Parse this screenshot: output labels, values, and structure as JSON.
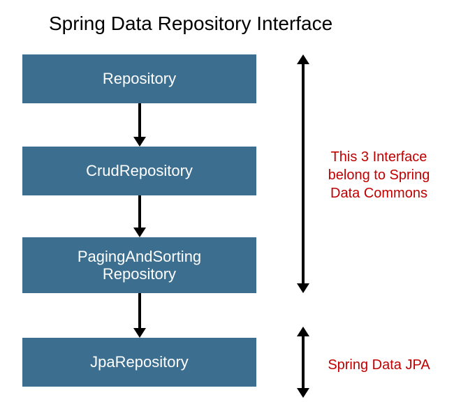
{
  "title": "Spring Data Repository Interface",
  "boxes": {
    "b1": "Repository",
    "b2": "CrudRepository",
    "b3_line1": "PagingAndSorting",
    "b3_line2": "Repository",
    "b4": "JpaRepository"
  },
  "annotations": {
    "group1_line1": "This 3 Interface",
    "group1_line2": "belong to Spring",
    "group1_line3": "Data Commons",
    "group2": "Spring Data JPA"
  }
}
